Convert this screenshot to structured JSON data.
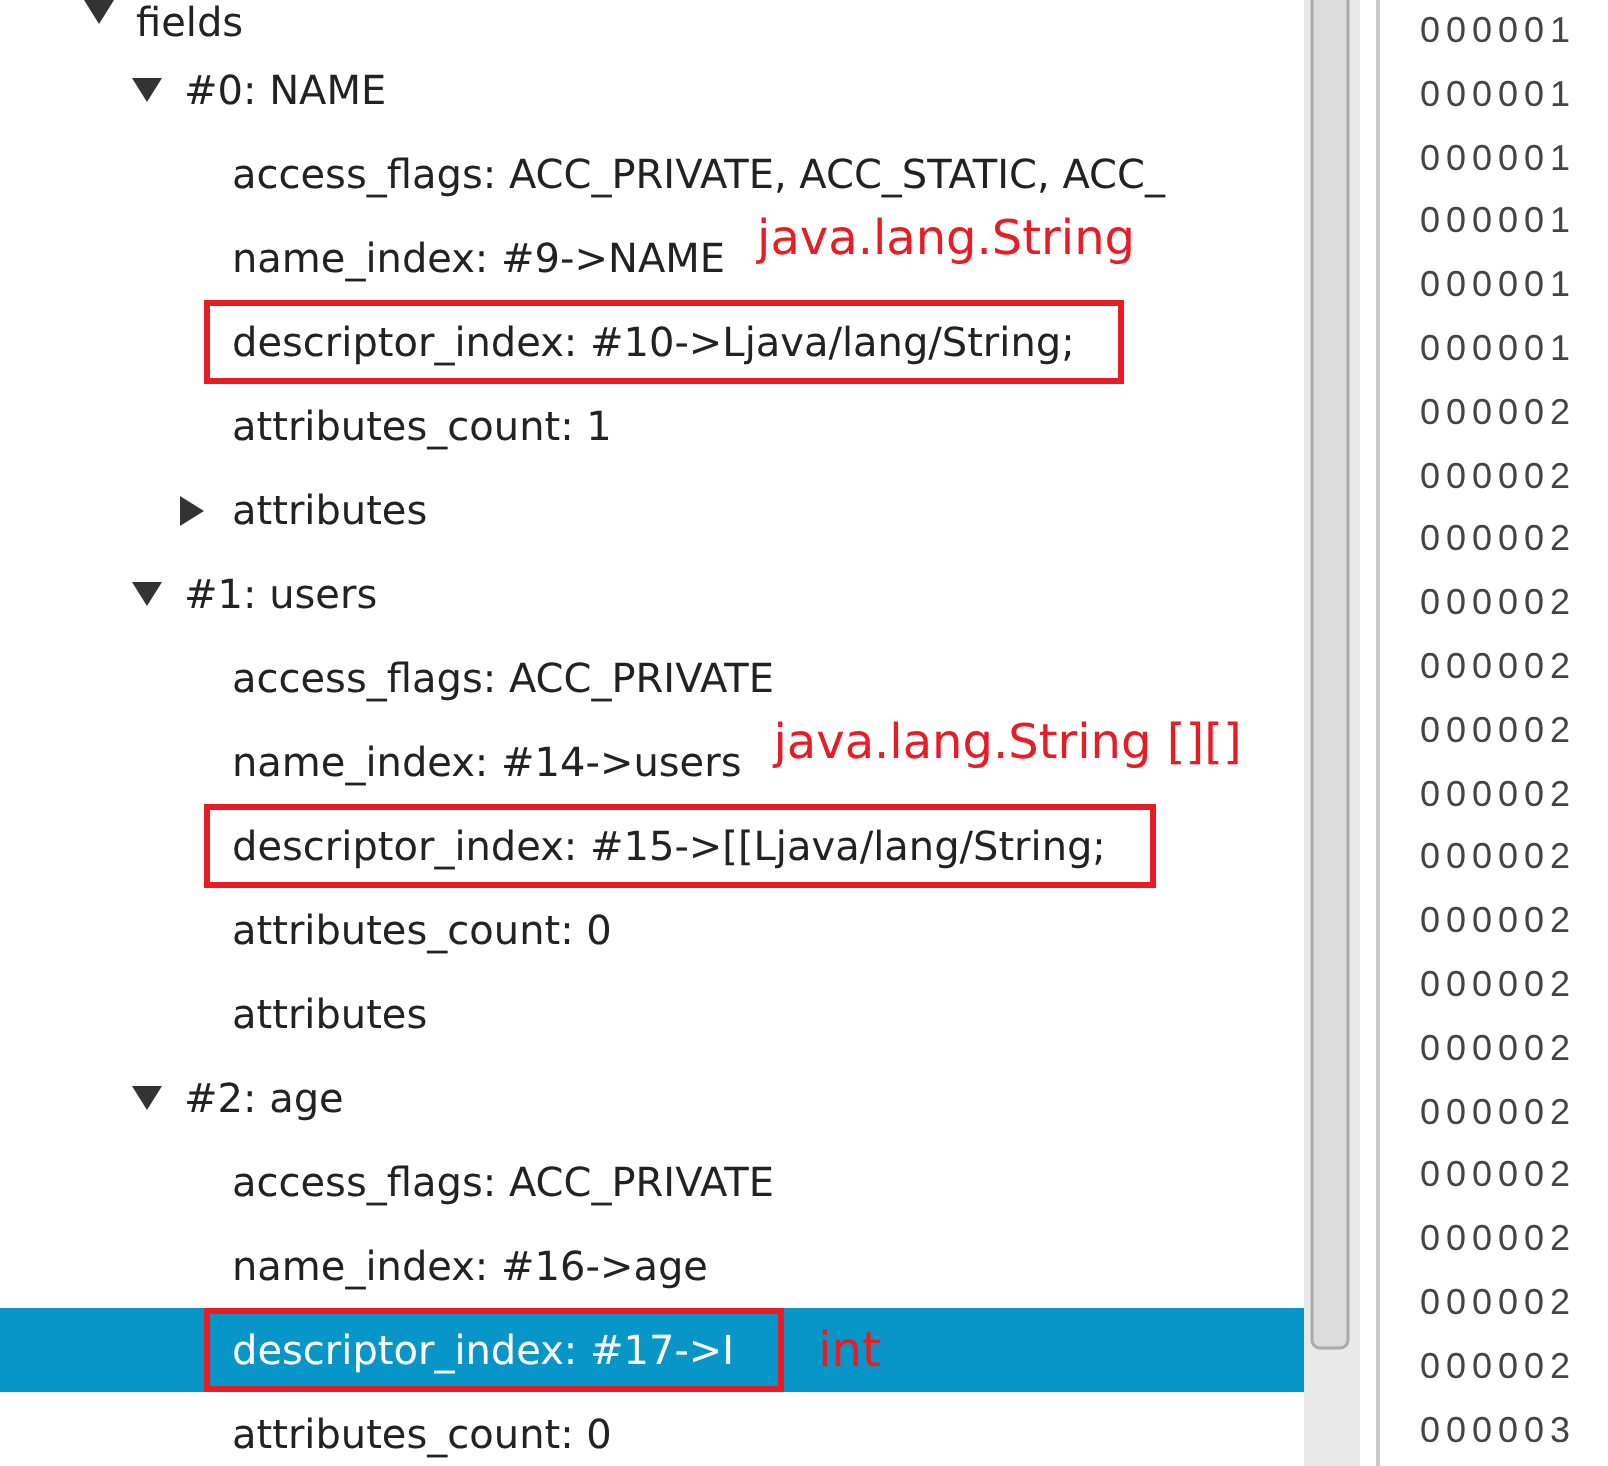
{
  "tree": [
    {
      "label": "fields",
      "expanded": true,
      "children": [
        {
          "label": "#0: NAME",
          "expanded": true,
          "children": [
            {
              "label": "access_flags: ACC_PRIVATE, ACC_STATIC, ACC_"
            },
            {
              "label": "name_index: #9->NAME",
              "note": "java.lang.String"
            },
            {
              "label": "descriptor_index: #10->Ljava/lang/String;",
              "boxed": true,
              "selected": false
            },
            {
              "label": "attributes_count: 1"
            },
            {
              "label": "attributes",
              "expanded": false
            }
          ]
        },
        {
          "label": "#1: users",
          "expanded": true,
          "children": [
            {
              "label": "access_flags: ACC_PRIVATE"
            },
            {
              "label": "name_index: #14->users",
              "note": "java.lang.String [][]"
            },
            {
              "label": "descriptor_index: #15->[[Ljava/lang/String;",
              "boxed": true,
              "selected": false
            },
            {
              "label": "attributes_count: 0"
            },
            {
              "label": "attributes"
            }
          ]
        },
        {
          "label": "#2: age",
          "expanded": true,
          "children": [
            {
              "label": "access_flags: ACC_PRIVATE"
            },
            {
              "label": "name_index: #16->age"
            },
            {
              "label": "descriptor_index: #17->I",
              "boxed": true,
              "selected": true,
              "note": "int"
            },
            {
              "label": "attributes_count: 0"
            }
          ]
        }
      ]
    }
  ],
  "offsets": [
    "000001",
    "000001",
    "000001",
    "000001",
    "000001",
    "000001",
    "000002",
    "000002",
    "000002",
    "000002",
    "000002",
    "000002",
    "000002",
    "000002",
    "000002",
    "000002",
    "000002",
    "000002",
    "000002",
    "000002",
    "000002",
    "000002",
    "000003"
  ]
}
